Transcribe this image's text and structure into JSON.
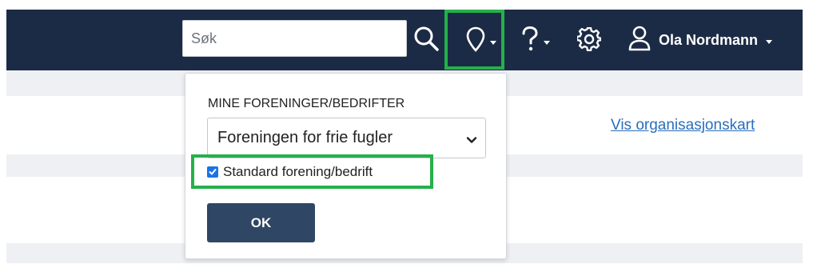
{
  "header": {
    "search": {
      "placeholder": "Søk",
      "value": ""
    },
    "user": {
      "name": "Ola Nordmann"
    },
    "icons": [
      "search-icon",
      "location-pin-icon",
      "help-icon",
      "gear-icon",
      "user-icon"
    ]
  },
  "main": {
    "org_chart_link": "Vis organisasjonskart"
  },
  "org_dropdown": {
    "title": "MINE FORENINGER/BEDRIFTER",
    "selected_org": "Foreningen for frie fugler",
    "default_checkbox": {
      "label": "Standard forening/bedrift",
      "checked": true
    },
    "ok_label": "OK"
  },
  "colors": {
    "navbar": "#1c2b45",
    "highlight": "#25b04a",
    "link": "#2a6ebb",
    "ok_button": "#2f4664",
    "checkbox": "#1a73e8"
  }
}
